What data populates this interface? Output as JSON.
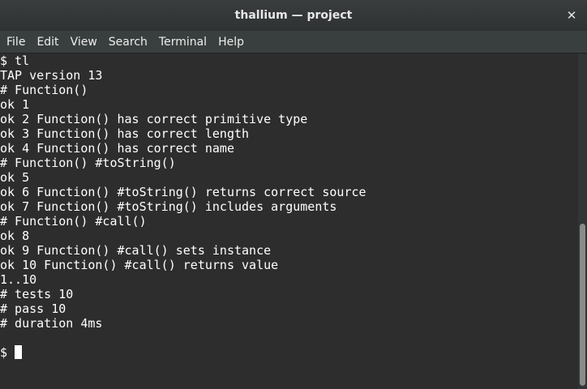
{
  "window": {
    "title": "thallium — project",
    "close_glyph": "✕"
  },
  "menu": {
    "items": [
      "File",
      "Edit",
      "View",
      "Search",
      "Terminal",
      "Help"
    ]
  },
  "terminal": {
    "lines": [
      "$ tl",
      "TAP version 13",
      "# Function()",
      "ok 1",
      "ok 2 Function() has correct primitive type",
      "ok 3 Function() has correct length",
      "ok 4 Function() has correct name",
      "# Function() #toString()",
      "ok 5",
      "ok 6 Function() #toString() returns correct source",
      "ok 7 Function() #toString() includes arguments",
      "# Function() #call()",
      "ok 8",
      "ok 9 Function() #call() sets instance",
      "ok 10 Function() #call() returns value",
      "1..10",
      "# tests 10",
      "# pass 10",
      "# duration 4ms"
    ],
    "prompt": "$"
  },
  "colors": {
    "background": "#2d2d2d",
    "text": "#ffffff",
    "titlebar": "#353839",
    "menubar": "#393f3f"
  }
}
